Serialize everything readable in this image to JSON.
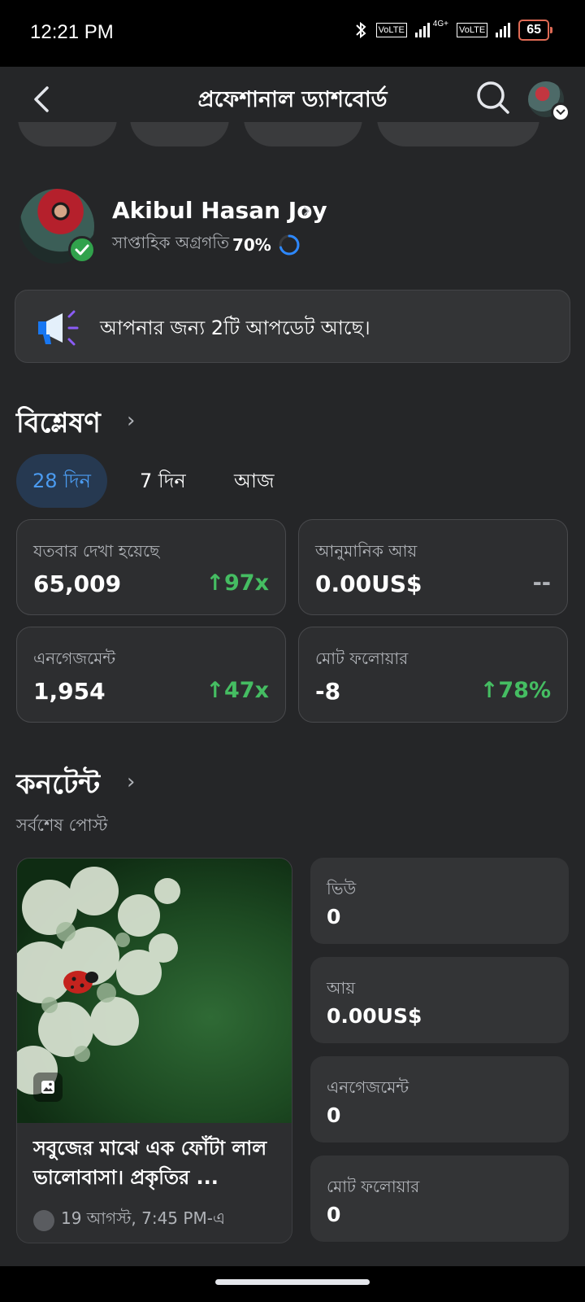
{
  "status_bar": {
    "time": "12:21 PM",
    "sim1": "VoLTE",
    "net": "4G+",
    "sim2": "VoLTE",
    "battery": "65"
  },
  "header": {
    "title": "প্রফেশানাল ড্যাশবোর্ড"
  },
  "profile": {
    "name": "Akibul Hasan Joy",
    "progress_label": "সাপ্তাহিক অগ্রগতি",
    "progress_value": "70%",
    "progress_fraction": 0.7
  },
  "notice": {
    "text": "আপনার জন্য 2টি আপডেট আছে।"
  },
  "analytics": {
    "title": "বিশ্লেষণ",
    "tabs": [
      {
        "label": "28 দিন"
      },
      {
        "label": "7 দিন"
      },
      {
        "label": "আজ"
      }
    ],
    "stats": [
      {
        "label": "যতবার দেখা হয়েছে",
        "value": "65,009",
        "change": "↑97x"
      },
      {
        "label": "আনুমানিক আয়",
        "value": "0.00US$",
        "change": "--"
      },
      {
        "label": "এনগেজমেন্ট",
        "value": "1,954",
        "change": "↑47x"
      },
      {
        "label": "মোট ফলোয়ার",
        "value": "-8",
        "change": "↑78%"
      }
    ]
  },
  "content": {
    "title": "কনটেন্ট",
    "subtitle": "সর্বশেষ পোস্ট",
    "post": {
      "caption": "সবুজের মাঝে এক ফোঁটা লাল ভালোবাসা। প্রকৃতির ...",
      "date": "19 আগস্ট, 7:45 PM-এ"
    },
    "metrics": [
      {
        "label": "ভিউ",
        "value": "0"
      },
      {
        "label": "আয়",
        "value": "0.00US$"
      },
      {
        "label": "এনগেজমেন্ট",
        "value": "0"
      },
      {
        "label": "মোট ফলোয়ার",
        "value": "0"
      }
    ]
  },
  "colors": {
    "background": "#252628",
    "accent": "#4b9bf0",
    "positive": "#45bd62",
    "verified": "#31a24c"
  }
}
